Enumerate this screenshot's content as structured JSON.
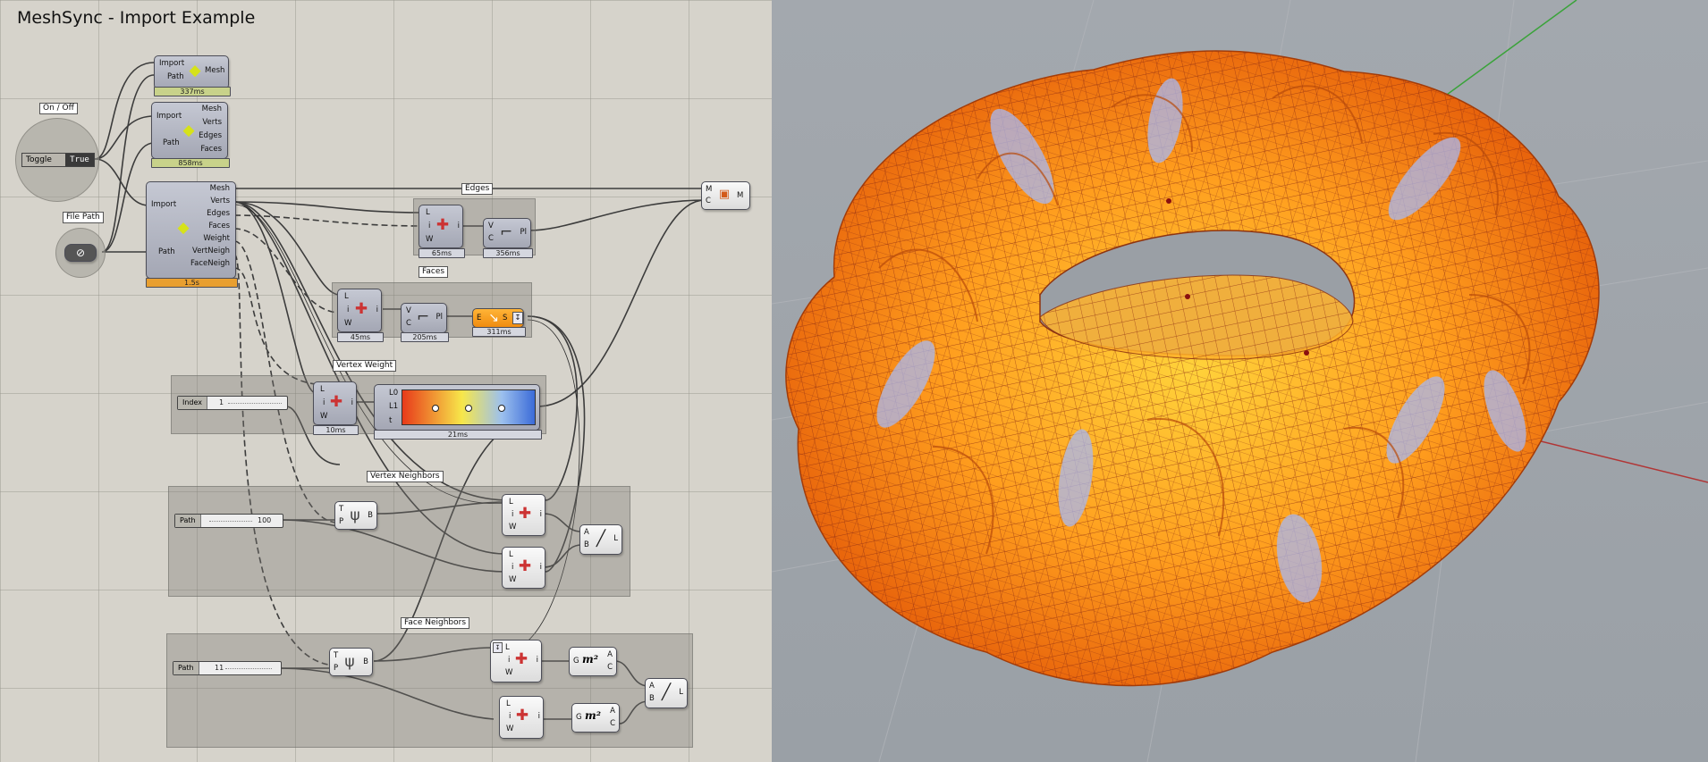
{
  "window": {
    "title": "MeshSync - Import Example"
  },
  "groups": {
    "edges": "Edges",
    "faces": "Faces",
    "vertex_weight": "Vertex Weight",
    "vertex_neighbors": "Vertex Neighbors",
    "face_neighbors": "Face Neighbors"
  },
  "toggle": {
    "label": "On / Off",
    "name": "Toggle",
    "value": "True"
  },
  "file_path": {
    "label": "File Path"
  },
  "import_small": {
    "inputs": [
      "Import",
      "Path"
    ],
    "output": "Mesh",
    "time": "337ms"
  },
  "import_medium": {
    "inputs": [
      "Import",
      "Path"
    ],
    "outputs": [
      "Mesh",
      "Verts",
      "Edges",
      "Faces"
    ],
    "time": "858ms"
  },
  "import_large": {
    "inputs": [
      "Import",
      "Path"
    ],
    "outputs": [
      "Mesh",
      "Verts",
      "Edges",
      "Faces",
      "Weight",
      "VertNeigh",
      "FaceNeigh"
    ],
    "time": "1.5s"
  },
  "mesh_preview": {
    "inputs": [
      "M",
      "C"
    ],
    "output": "M"
  },
  "edges_list": {
    "inputs": [
      "L",
      "i",
      "W"
    ],
    "output": "i",
    "time": "65ms"
  },
  "edges_endpoints": {
    "inputs": [
      "V",
      "C"
    ],
    "output": "Pl",
    "time": "356ms"
  },
  "faces_list": {
    "inputs": [
      "L",
      "i",
      "W"
    ],
    "output": "i",
    "time": "45ms"
  },
  "faces_endpoints": {
    "inputs": [
      "V",
      "C"
    ],
    "output": "Pl",
    "time": "205ms"
  },
  "faces_explode": {
    "inputs": [
      "E"
    ],
    "output": "S",
    "time": "311ms"
  },
  "index_slider": {
    "name": "Index",
    "value": "1"
  },
  "weight_list": {
    "inputs": [
      "L",
      "i",
      "W"
    ],
    "output": "i",
    "time": "10ms"
  },
  "gradient": {
    "inputs": [
      "L0",
      "L1",
      "t"
    ],
    "time": "21ms",
    "colors": [
      "#e83a1a",
      "#f7e74a",
      "#9cc0ee",
      "#3b6bd8"
    ]
  },
  "path_slider_1": {
    "name": "Path",
    "value": "100"
  },
  "path_slider_2": {
    "name": "Path",
    "value": "11"
  },
  "tree_1": {
    "inputs": [
      "T",
      "P"
    ],
    "output": "B"
  },
  "tree_2": {
    "inputs": [
      "T",
      "P"
    ],
    "output": "B"
  },
  "vn_list_a": {
    "inputs": [
      "L",
      "i",
      "W"
    ],
    "output": "i"
  },
  "vn_list_b": {
    "inputs": [
      "L",
      "i",
      "W"
    ],
    "output": "i"
  },
  "vn_line": {
    "inputs": [
      "A",
      "B"
    ],
    "output": "L"
  },
  "fn_list_a": {
    "inputs": [
      "L",
      "i",
      "W"
    ],
    "output": "i"
  },
  "fn_list_b": {
    "inputs": [
      "L",
      "i",
      "W"
    ],
    "output": "i"
  },
  "fn_area_a": {
    "inputs": [
      "G"
    ],
    "outputs": [
      "A",
      "C"
    ],
    "symbol": "m²"
  },
  "fn_area_b": {
    "inputs": [
      "G"
    ],
    "outputs": [
      "A",
      "C"
    ],
    "symbol": "m²"
  },
  "fn_line": {
    "inputs": [
      "A",
      "B"
    ],
    "output": "L"
  },
  "viewport": {
    "axis_colors": {
      "x": "#b03030",
      "y": "#30a030"
    },
    "mesh_colors": [
      "#f07010",
      "#ffd23a",
      "#a7b9f0"
    ]
  }
}
